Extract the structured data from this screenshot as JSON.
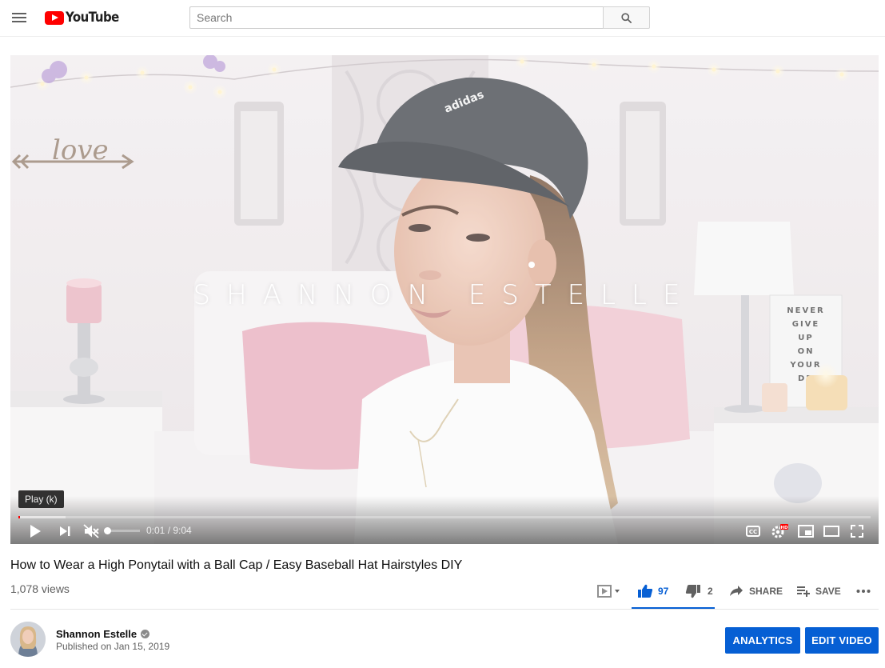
{
  "header": {
    "logo_text": "YouTube",
    "search_placeholder": "Search",
    "icons": [
      "menu-icon",
      "youtube-logo",
      "search-icon"
    ]
  },
  "player": {
    "overlay_text": "SHANNON ESTELLE",
    "tooltip": "Play (k)",
    "time_current": "0:01",
    "time_total": "9:04",
    "time_display": "0:01 / 9:04",
    "progress_fraction": 0.002,
    "buffered_fraction": 0.055,
    "volume_muted": true,
    "volume_fraction": 0.0,
    "icons": [
      "play-icon",
      "next-icon",
      "volume-muted-icon",
      "captions-icon",
      "settings-hd-icon",
      "miniplayer-icon",
      "theater-icon",
      "fullscreen-icon"
    ],
    "scene_sign_text": [
      "NEVER",
      "GIVE",
      "UP",
      "ON",
      "YOUR",
      "DR"
    ],
    "scene_wall_text": "love",
    "scene_cap_text": "adidas"
  },
  "video": {
    "title": "How to Wear a High Ponytail with a Ball Cap / Easy Baseball Hat Hairstyles DIY",
    "views": "1,078 views",
    "likes": "97",
    "dislikes": "2",
    "share_label": "SHARE",
    "save_label": "SAVE"
  },
  "channel": {
    "name": "Shannon Estelle",
    "published": "Published on Jan 15, 2019",
    "verified": true
  },
  "owner_actions": {
    "analytics_label": "ANALYTICS",
    "edit_label": "EDIT VIDEO"
  },
  "colors": {
    "brand_red": "#ff0000",
    "accent_blue": "#065fd4",
    "secondary_text": "#606060"
  }
}
